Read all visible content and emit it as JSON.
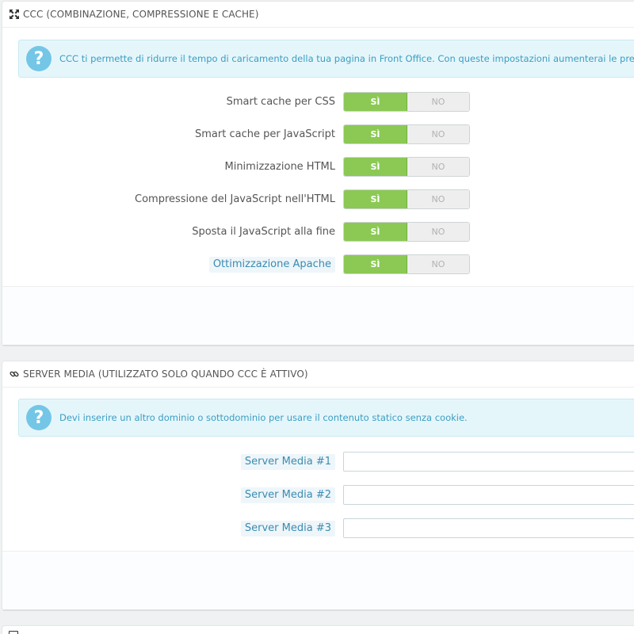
{
  "ccc_panel": {
    "title": "CCC (COMBINAZIONE, COMPRESSIONE E CACHE)",
    "icon": "expand-arrows-icon",
    "info_text": "CCC ti permette di ridurre il tempo di caricamento della tua pagina in Front Office. Con queste impostazioni aumenterai le prestazioni",
    "yes_label": "SÌ",
    "no_label": "NO",
    "options": [
      {
        "label": "Smart cache per CSS",
        "value": "yes"
      },
      {
        "label": "Smart cache per JavaScript",
        "value": "yes"
      },
      {
        "label": "Minimizzazione HTML",
        "value": "yes"
      },
      {
        "label": "Compressione del JavaScript nell'HTML",
        "value": "yes"
      },
      {
        "label": "Sposta il JavaScript alla fine",
        "value": "yes"
      },
      {
        "label": "Ottimizzazione Apache",
        "value": "yes"
      }
    ]
  },
  "media_panel": {
    "title": "SERVER MEDIA (UTILIZZATO SOLO QUANDO CCC È ATTIVO)",
    "icon": "link-icon",
    "info_text": "Devi inserire un altro dominio o sottodominio per usare il contenuto statico senza cookie.",
    "fields": [
      {
        "label": "Server Media #1",
        "value": ""
      },
      {
        "label": "Server Media #2",
        "value": ""
      },
      {
        "label": "Server Media #3",
        "value": ""
      }
    ]
  },
  "colors": {
    "toggle_on": "#8bc954",
    "toggle_off": "#eeeeee",
    "info_bg": "#e5f6fb",
    "info_text": "#3b9ec2",
    "help_icon": "#74c6e6"
  }
}
